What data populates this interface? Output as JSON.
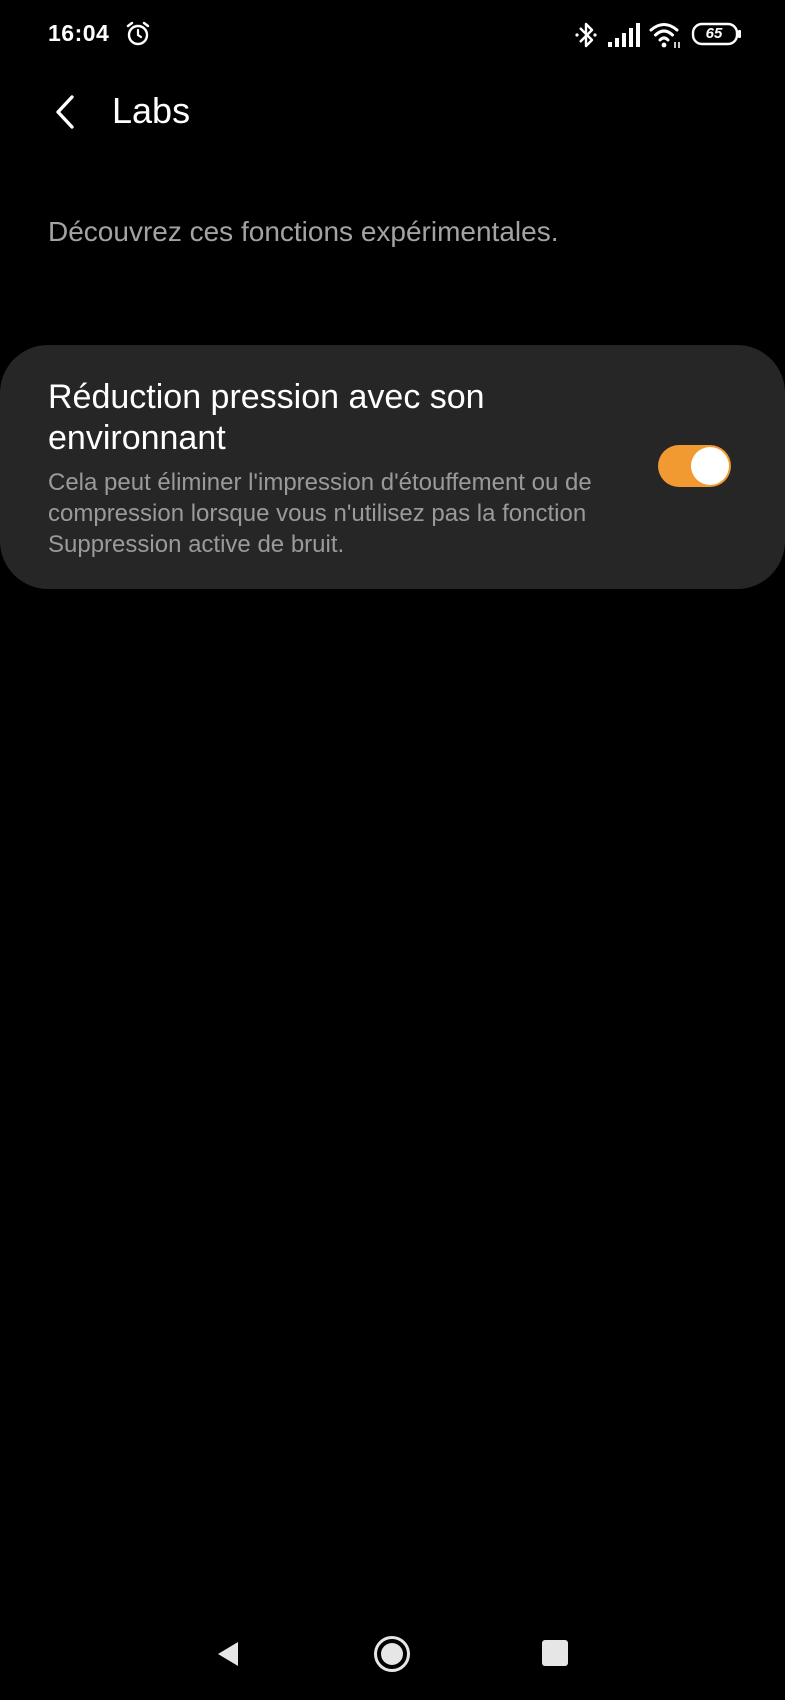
{
  "status_bar": {
    "time": "16:04",
    "battery_level": "65",
    "icons": [
      "alarm-icon",
      "bluetooth-icon",
      "signal-icon",
      "wifi-icon",
      "battery-icon"
    ]
  },
  "header": {
    "title": "Labs",
    "back_icon": "chevron-left-icon"
  },
  "intro": "Découvrez ces fonctions expérimentales.",
  "settings": [
    {
      "title": "Réduction pression avec son environnant",
      "description": "Cela peut éliminer l'impression d'étouffement ou de compression lorsque vous n'utilisez pas la fonction Suppression active de bruit.",
      "enabled": true
    }
  ],
  "nav_bar": {
    "icons": [
      "nav-back-icon",
      "nav-home-icon",
      "nav-recents-icon"
    ]
  },
  "colors": {
    "background": "#000000",
    "card": "#262626",
    "accent": "#f19a32",
    "primary_text": "#ffffff",
    "secondary_text": "#9a9a9a"
  }
}
